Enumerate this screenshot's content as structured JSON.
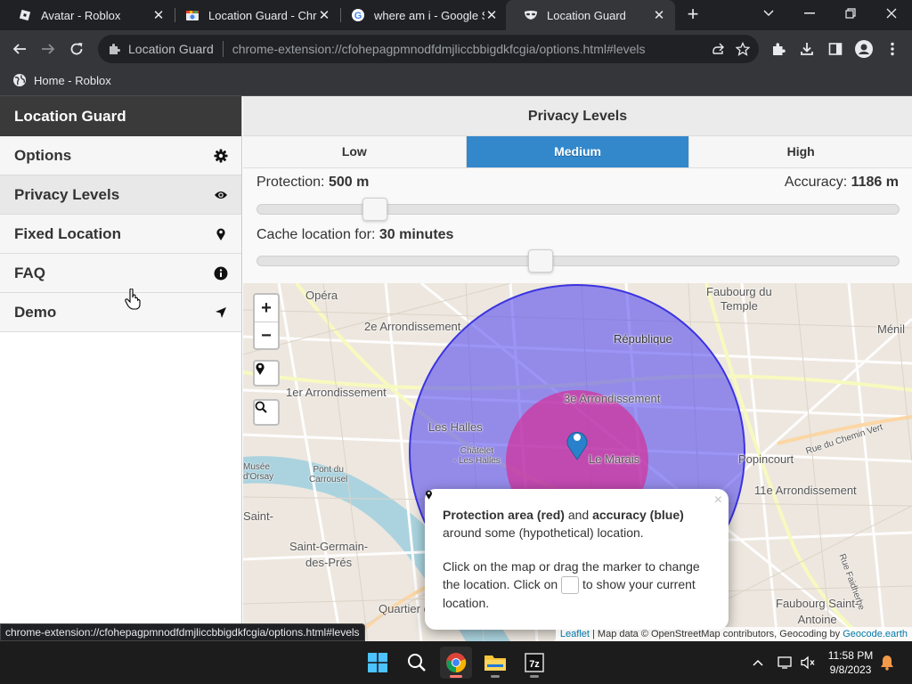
{
  "browser": {
    "tabs": [
      {
        "title": "Avatar - Roblox"
      },
      {
        "title": "Location Guard - Chrom"
      },
      {
        "title": "where am i - Google Se"
      },
      {
        "title": "Location Guard"
      }
    ],
    "omnibox": {
      "site": "Location Guard",
      "url": "chrome-extension://cfohepagpmnodfdmjliccbbigdkfcgia/options.html#levels"
    },
    "bookmarks": [
      {
        "label": "Home - Roblox"
      }
    ],
    "status_url": "chrome-extension://cfohepagpmnodfdmjliccbbigdkfcgia/options.html#levels"
  },
  "sidebar": {
    "title": "Location Guard",
    "items": [
      {
        "label": "Options",
        "icon": "gear-icon"
      },
      {
        "label": "Privacy Levels",
        "icon": "eye-icon"
      },
      {
        "label": "Fixed Location",
        "icon": "map-pin-icon"
      },
      {
        "label": "FAQ",
        "icon": "info-icon"
      },
      {
        "label": "Demo",
        "icon": "location-arrow-icon"
      }
    ],
    "active_item": "Privacy Levels"
  },
  "main": {
    "title": "Privacy Levels",
    "levels": [
      "Low",
      "Medium",
      "High"
    ],
    "selected_level": "Medium",
    "protection": {
      "label": "Protection:",
      "value": "500 m",
      "slider_fraction": 0.17
    },
    "accuracy": {
      "label": "Accuracy:",
      "value": "1186 m"
    },
    "cache": {
      "label": "Cache location for:",
      "value": "30 minutes",
      "slider_fraction": 0.44
    }
  },
  "map": {
    "zoom_in": "+",
    "zoom_out": "−",
    "labels": {
      "opera": "Opéra",
      "arr2": "2e Arrondissement",
      "faubourg_temple": "Faubourg du\nTemple",
      "republique": "République",
      "menil": "Ménil",
      "arr1": "1er Arrondissement",
      "arr3": "3e Arrondissement",
      "les_halles": "Les Halles",
      "chatelet": "Châtelet\n- Les Halles",
      "le_marais": "Le Marais",
      "popincourt": "Popincourt",
      "chemin_vert": "Rue du Chemin Vert",
      "musee": "Musée\nd'Orsay",
      "pont": "Pont du\nCarrousel",
      "arr11": "11e Arrondissement",
      "saint": "Saint-",
      "saint_germain": "Saint-Germain-\ndes-Prés",
      "faidherbe": "Rue Faidherbe",
      "faubourg_antoine": "Faubourg Saint-\nAntoine",
      "quartier": "Quartier de"
    },
    "popup": {
      "close": "×",
      "bold1": "Protection area (red)",
      "and": " and ",
      "bold2": "accuracy (blue)",
      "line1_rest": " around some (hypothetical) location.",
      "para2_a": "Click on the map or drag the marker to change the location. Click on ",
      "para2_b": " to show your current location."
    },
    "attribution": {
      "leaflet": "Leaflet",
      "mid": " | Map data © OpenStreetMap contributors, Geocoding by ",
      "geocode": "Geocode.earth"
    },
    "colors": {
      "protection": "#e0208a",
      "accuracy": "#4a3ff0"
    }
  },
  "taskbar": {
    "time": "11:58 PM",
    "date": "9/8/2023",
    "apps": [
      "windows-start-icon",
      "search-icon",
      "chrome-icon",
      "file-explorer-icon",
      "7zip-icon"
    ]
  }
}
